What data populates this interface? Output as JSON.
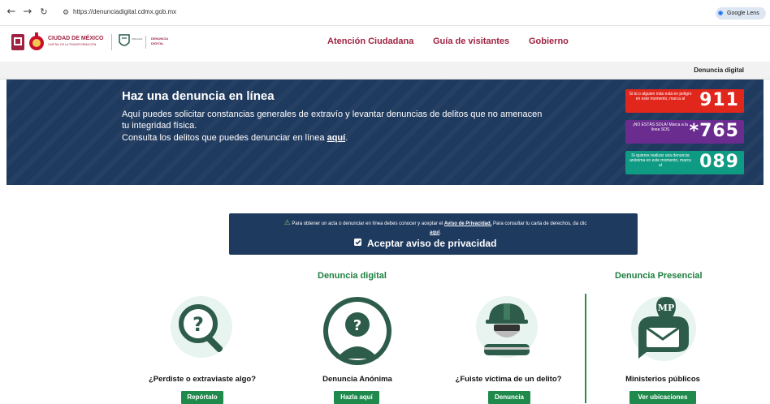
{
  "browser": {
    "url": "https://denunciadigital.cdmx.gob.mx",
    "lens_label": "Google Lens"
  },
  "header": {
    "logo_cdmx_title": "CIUDAD DE MÉXICO",
    "logo_cdmx_sub": "CAPITAL DE LA TRANSFORMACIÓN",
    "logo_fgj_title": "DENUNCIA",
    "logo_fgj_sub": "DIGITAL",
    "nav": [
      "Atención Ciudadana",
      "Guía de visitantes",
      "Gobierno"
    ]
  },
  "subbar": {
    "label": "Denuncia digital"
  },
  "banner": {
    "title": "Haz una denuncia en línea",
    "desc": "Aquí puedes solicitar constancias generales de extravío y levantar denuncias de delitos que no amenacen tu integridad física.",
    "consult_prefix": "Consulta los delitos que puedes denunciar en línea ",
    "consult_link": "aquí",
    "consult_suffix": "."
  },
  "hotlines": [
    {
      "text": "Si tú o alguien más está en peligro en este momento, marca al",
      "number": "911",
      "color": "#e1261c"
    },
    {
      "text": "¡NO ESTÁS SOLA! Marca a la línea SOS",
      "number": "*765",
      "color": "#6a2c8f"
    },
    {
      "text": "Si quieres realizar una denuncia anónima en este momento, marca al",
      "number": "089",
      "color": "#0f9a83"
    }
  ],
  "privacy": {
    "text_prefix": "Para obtener un acta o denunciar en línea debes conocer y aceptar el ",
    "link1": "Aviso de Privacidad.",
    "text_mid": " Para consultar tu carta de derechos, da clic ",
    "link2": "aquí",
    "text_suffix": ".",
    "accept_label": "Aceptar aviso de privacidad",
    "accepted": true
  },
  "sections": {
    "digital_title": "Denuncia digital",
    "presencial_title": "Denuncia Presencial"
  },
  "cards": [
    {
      "label": "¿Perdiste o extraviaste algo?",
      "button": "Repórtalo",
      "icon": "search-question-icon"
    },
    {
      "label": "Denuncia Anónima",
      "button": "Hazla aquí",
      "icon": "anonymous-person-icon"
    },
    {
      "label": "¿Fuiste víctima de un delito?",
      "button": "Denuncia",
      "icon": "worker-helmet-icon"
    },
    {
      "label": "Ministerios públicos",
      "button": "Ver ubicaciones",
      "icon": "mp-location-icon",
      "badge": "MP"
    }
  ],
  "colors": {
    "brand": "#9f2241",
    "banner_bg": "#1f3a5f",
    "green": "#1f8a4c",
    "section_green": "#1d7e3f"
  }
}
